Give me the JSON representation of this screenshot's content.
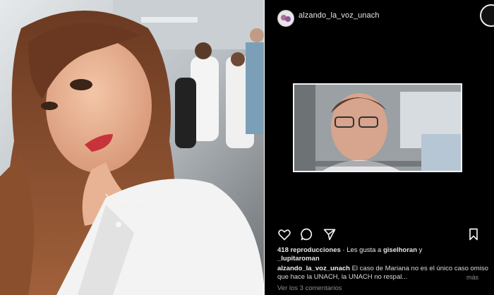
{
  "post": {
    "username": "alzando_la_voz_unach",
    "views_count": "418 reproducciones",
    "likes_prefix": "· Les gusta a",
    "liker_1": "giselhoran",
    "likes_joiner": "y",
    "liker_2": "_lupitaroman",
    "caption_username": "alzando_la_voz_unach",
    "caption_text": "El caso de Mariana no es el único caso omiso que hace la UNACH, la UNACH no respal...",
    "more_label": "más",
    "comments_link": "Ver los 3 comentarios"
  },
  "icons": {
    "like": "heart-icon",
    "comment": "comment-bubble-icon",
    "share": "paper-plane-icon",
    "save": "bookmark-icon"
  },
  "colors": {
    "background": "#000000",
    "text_primary": "#e8e8e8",
    "text_secondary": "#8e8e8e"
  }
}
